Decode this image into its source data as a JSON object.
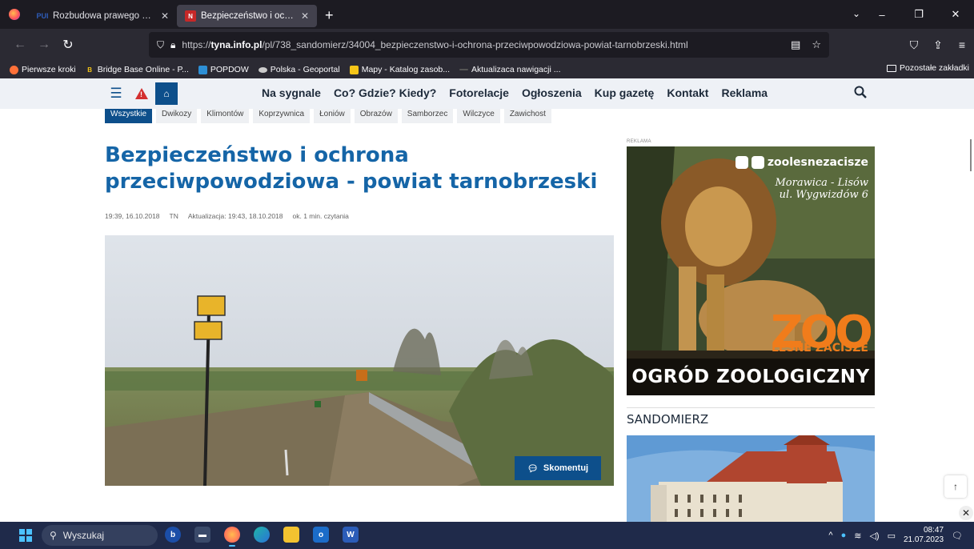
{
  "browser": {
    "tabs": [
      {
        "label": "Rozbudowa prawego wału Wis",
        "favicon": "PUI",
        "active": false
      },
      {
        "label": "Bezpieczeństwo i ochrona prze",
        "favicon": "N",
        "active": true
      }
    ],
    "new_tab": "+",
    "url_prefix": "https://",
    "url_domain": "tyna.info.pl",
    "url_path": "/pl/738_sandomierz/34004_bezpieczenstwo-i-ochrona-przeciwpowodziowa-powiat-tarnobrzeski.html",
    "bookmarks": [
      {
        "label": "Pierwsze kroki",
        "icon": "firefox-icon",
        "color": "#ff7139"
      },
      {
        "label": "Bridge Base Online - P...",
        "icon": "B",
        "color": "#f5c518"
      },
      {
        "label": "POPDOW",
        "icon": "popdow-icon",
        "color": "#2d8fd5"
      },
      {
        "label": "Polska - Geoportal",
        "icon": "geoportal-icon",
        "color": "#cccccc"
      },
      {
        "label": "Mapy - Katalog zasob...",
        "icon": "mapy-icon",
        "color": "#f5c518"
      },
      {
        "label": "Aktualizaca nawigacji ...",
        "icon": "dash",
        "color": "#555555"
      }
    ],
    "other_bookmarks": "Pozostałe zakładki"
  },
  "site": {
    "menu": [
      "Na sygnale",
      "Co? Gdzie? Kiedy?",
      "Fotorelacje",
      "Ogłoszenia",
      "Kup gazetę",
      "Kontakt",
      "Reklama"
    ],
    "filters": [
      "Wszystkie",
      "Dwikozy",
      "Klimontów",
      "Koprzywnica",
      "Łoniów",
      "Obrazów",
      "Samborzec",
      "Wilczyce",
      "Zawichost"
    ],
    "accent": "#0d4f8b"
  },
  "article": {
    "title": "Bezpieczeństwo i ochrona przeciwpowodziowa - powiat tarnobrzeski",
    "date": "19:39, 16.10.2018",
    "author": "TN",
    "updated": "Aktualizacja: 19:43, 18.10.2018",
    "reading_time": "ok. 1 min. czytania",
    "comment_button": "Skomentuj"
  },
  "sidebar": {
    "ad_label": "REKLAMA",
    "ad": {
      "social": "zoolesnezacisze",
      "address_line1": "Morawica - Lisów",
      "address_line2": "ul. Wygwizdów 6",
      "zoo": "ZOO",
      "lesne": "LEŚNE ZACISZE",
      "bottom": "OGRÓD ZOOLOGICZNY"
    },
    "section_heading": "SANDOMIERZ"
  },
  "taskbar": {
    "search_placeholder": "Wyszukaj",
    "time": "08:47",
    "date": "21.07.2023"
  }
}
